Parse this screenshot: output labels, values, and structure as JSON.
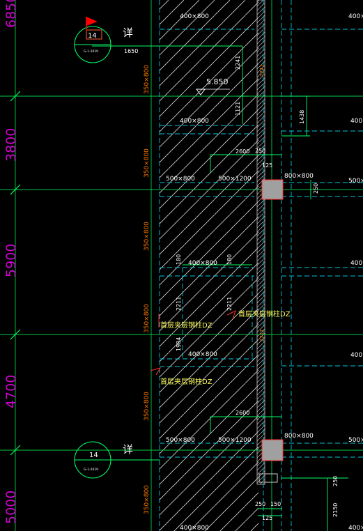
{
  "colors": {
    "background": "#000000",
    "axis_green": "#00cc44",
    "dim_green": "#00ff66",
    "beam_cyan": "#00c8e0",
    "hatch_white": "#d8d8d8",
    "text_white": "#ffffff",
    "text_magenta": "#d000d0",
    "text_orange": "#ff7a00",
    "text_yellow": "#ffff60",
    "flag_red": "#ff0000",
    "column_gray": "#a0a0a0"
  },
  "grid_spacings": [
    "6850",
    "3800",
    "5900",
    "4700",
    "5000"
  ],
  "detail_callouts": [
    {
      "number": "14",
      "sheet": "G-1-2019",
      "label": "详"
    },
    {
      "number": "14",
      "sheet": "G-1-2019",
      "label": "详"
    }
  ],
  "beam_sizes": {
    "b400x800": "400×800",
    "b500x800": "500×800",
    "b500x1200": "500×1200",
    "b800x800": "800×800",
    "b350x800": "350×800"
  },
  "dimensions": {
    "d1650": "1650",
    "d2241": "2241",
    "d1121": "1121",
    "d1438": "1438",
    "d2600": "2600",
    "d250": "250",
    "d125": "125",
    "d180": "180",
    "d2211": "2211",
    "d1984": "1984",
    "d2150": "2150",
    "d150": "150"
  },
  "level_mark": "5.850",
  "notes": {
    "opening_note": "首层夹层钢柱DZ"
  }
}
